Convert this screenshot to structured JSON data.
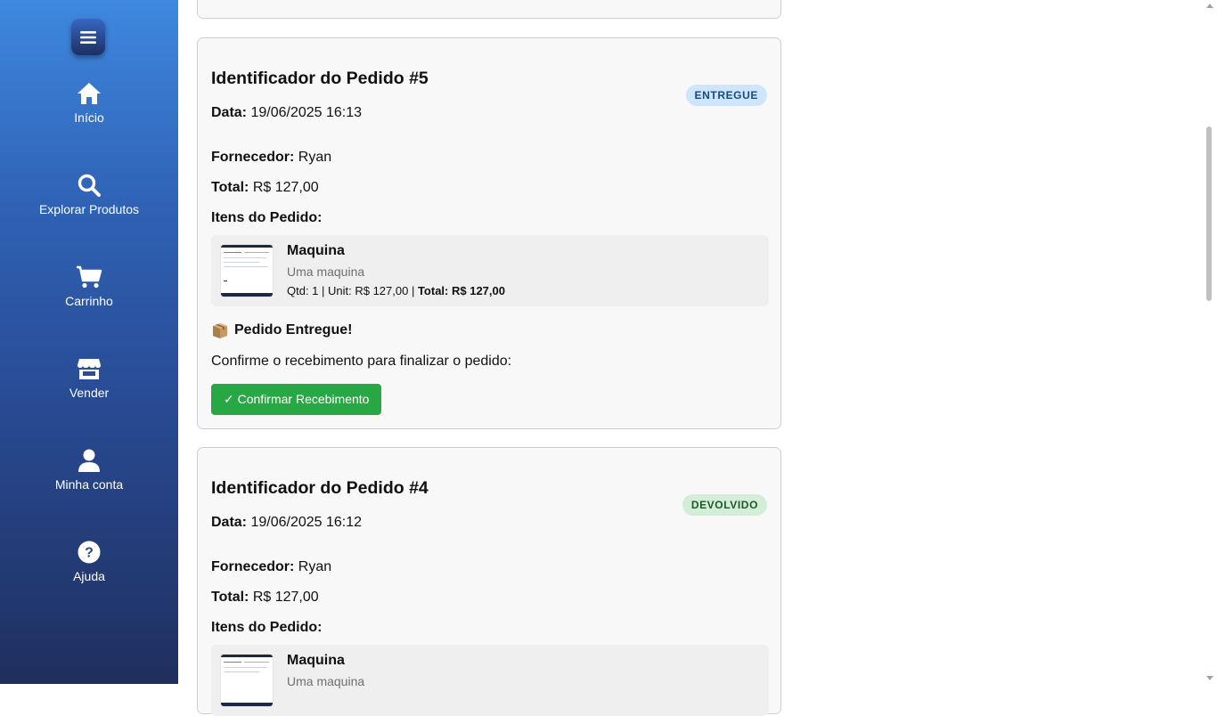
{
  "sidebar": {
    "items": [
      {
        "label": "Início",
        "icon": "home-icon"
      },
      {
        "label": "Explorar Produtos",
        "icon": "search-icon"
      },
      {
        "label": "Carrinho",
        "icon": "cart-icon"
      },
      {
        "label": "Vender",
        "icon": "store-icon"
      },
      {
        "label": "Minha conta",
        "icon": "user-icon"
      },
      {
        "label": "Ajuda",
        "icon": "help-icon"
      }
    ]
  },
  "orders": [
    {
      "title": "Identificador do Pedido #5",
      "status": "ENTREGUE",
      "date_label": "Data:",
      "date": "19/06/2025 16:13",
      "supplier_label": "Fornecedor:",
      "supplier": "Ryan",
      "total_label": "Total:",
      "total": "R$ 127,00",
      "items_label": "Itens do Pedido:",
      "item": {
        "name": "Maquina",
        "description": "Uma maquina",
        "qty_text": "Qtd: 1 | Unit: R$ 127,00 | ",
        "total_label": "Total: R$ 127,00"
      },
      "delivered_title": "Pedido Entregue!",
      "confirm_text": "Confirme o recebimento para finalizar o pedido:",
      "confirm_button": "✓ Confirmar Recebimento"
    },
    {
      "title": "Identificador do Pedido #4",
      "status": "DEVOLVIDO",
      "date_label": "Data:",
      "date": "19/06/2025 16:12",
      "supplier_label": "Fornecedor:",
      "supplier": "Ryan",
      "total_label": "Total:",
      "total": "R$ 127,00",
      "items_label": "Itens do Pedido:",
      "item": {
        "name": "Maquina",
        "description": "Uma maquina"
      }
    }
  ],
  "colors": {
    "sidebar_top": "#3f88e0",
    "sidebar_bottom": "#1f2f5e",
    "badge_delivered_bg": "#cfe5fb",
    "badge_returned_bg": "#d3edd9",
    "confirm_button": "#28a745"
  }
}
